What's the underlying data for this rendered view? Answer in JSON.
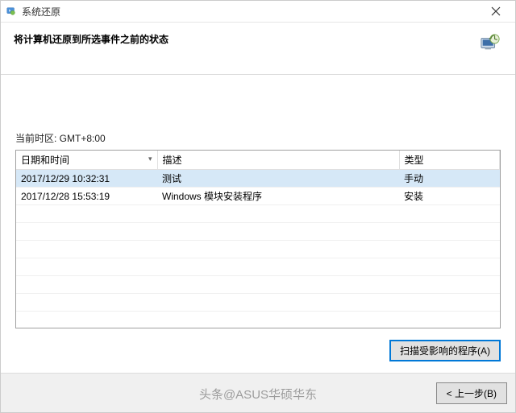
{
  "window": {
    "title": "系统还原",
    "heading": "将计算机还原到所选事件之前的状态"
  },
  "timezone_label": "当前时区: GMT+8:00",
  "table": {
    "columns": {
      "datetime": "日期和时间",
      "description": "描述",
      "type": "类型"
    },
    "rows": [
      {
        "datetime": "2017/12/29 10:32:31",
        "description": "测试",
        "type": "手动"
      },
      {
        "datetime": "2017/12/28 15:53:19",
        "description": "Windows 模块安装程序",
        "type": "安装"
      }
    ]
  },
  "buttons": {
    "scan_affected": "扫描受影响的程序(A)",
    "back": "< 上一步(B)"
  },
  "watermark": "头条@ASUS华硕华东"
}
